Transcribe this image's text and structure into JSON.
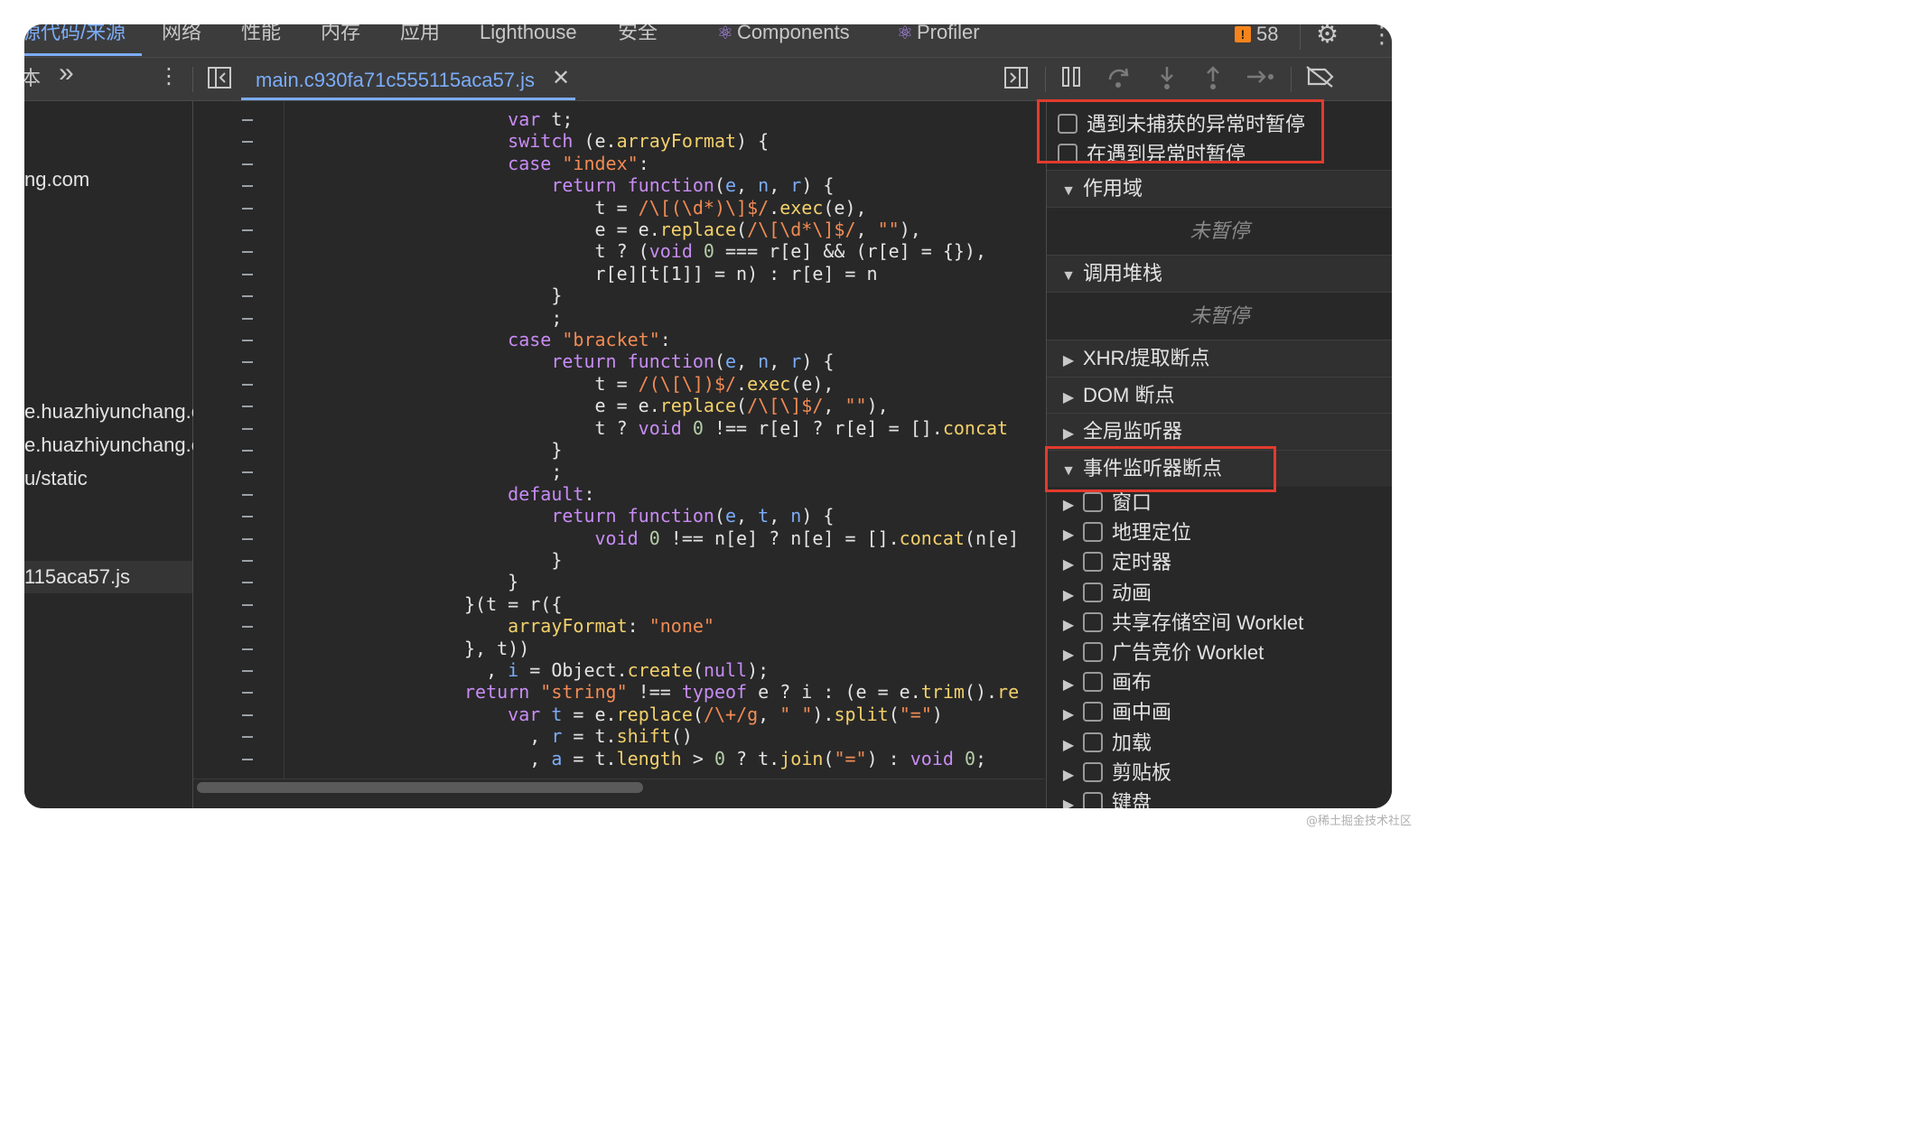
{
  "tabs": [
    "源代码/来源",
    "网络",
    "性能",
    "内存",
    "应用",
    "Lighthouse",
    "安全",
    "Components",
    "Profiler"
  ],
  "issues_count": "58",
  "toolbar": {
    "nav_overflow": "本",
    "more_tabs": "»",
    "file_tab": "main.c930fa71c555115aca57.js"
  },
  "navigator": {
    "items": [
      "ng.com",
      "e.huazhiyunchang.c",
      "e.huazhiyunchang.c",
      "u/static",
      "115aca57.js"
    ]
  },
  "code_lines": [
    [
      [
        "p",
        "    "
      ],
      [
        "kw",
        "var"
      ],
      [
        "p",
        " t;"
      ]
    ],
    [
      [
        "p",
        "    "
      ],
      [
        "kw",
        "switch"
      ],
      [
        "p",
        " (e."
      ],
      [
        "pr",
        "arrayFormat"
      ],
      [
        "p",
        ") {"
      ]
    ],
    [
      [
        "p",
        "    "
      ],
      [
        "kw",
        "case"
      ],
      [
        "p",
        " "
      ],
      [
        "str",
        "\"index\""
      ],
      [
        "p",
        ":"
      ]
    ],
    [
      [
        "p",
        "        "
      ],
      [
        "kw",
        "return"
      ],
      [
        "p",
        " "
      ],
      [
        "kw",
        "function"
      ],
      [
        "p",
        "("
      ],
      [
        "vr",
        "e"
      ],
      [
        "p",
        ", "
      ],
      [
        "vr",
        "n"
      ],
      [
        "p",
        ", "
      ],
      [
        "vr",
        "r"
      ],
      [
        "p",
        ") {"
      ]
    ],
    [
      [
        "p",
        "            t = "
      ],
      [
        "str",
        "/\\[(\\d*)\\]$/"
      ],
      [
        "p",
        "."
      ],
      [
        "fn",
        "exec"
      ],
      [
        "p",
        "(e),"
      ]
    ],
    [
      [
        "p",
        "            e = e."
      ],
      [
        "fn",
        "replace"
      ],
      [
        "p",
        "("
      ],
      [
        "str",
        "/\\[\\d*\\]$/"
      ],
      [
        "p",
        ", "
      ],
      [
        "str",
        "\"\""
      ],
      [
        "p",
        "),"
      ]
    ],
    [
      [
        "p",
        "            t ? ("
      ],
      [
        "kw",
        "void"
      ],
      [
        "p",
        " "
      ],
      [
        "num",
        "0"
      ],
      [
        "p",
        " === r[e] && (r[e] = {}),"
      ]
    ],
    [
      [
        "p",
        "            r[e][t[1]] = n) : r[e] = n"
      ]
    ],
    [
      [
        "p",
        "        }"
      ]
    ],
    [
      [
        "p",
        "        ;"
      ]
    ],
    [
      [
        "p",
        "    "
      ],
      [
        "kw",
        "case"
      ],
      [
        "p",
        " "
      ],
      [
        "str",
        "\"bracket\""
      ],
      [
        "p",
        ":"
      ]
    ],
    [
      [
        "p",
        "        "
      ],
      [
        "kw",
        "return"
      ],
      [
        "p",
        " "
      ],
      [
        "kw",
        "function"
      ],
      [
        "p",
        "("
      ],
      [
        "vr",
        "e"
      ],
      [
        "p",
        ", "
      ],
      [
        "vr",
        "n"
      ],
      [
        "p",
        ", "
      ],
      [
        "vr",
        "r"
      ],
      [
        "p",
        ") {"
      ]
    ],
    [
      [
        "p",
        "            t = "
      ],
      [
        "str",
        "/(\\[\\])$/"
      ],
      [
        "p",
        "."
      ],
      [
        "fn",
        "exec"
      ],
      [
        "p",
        "(e),"
      ]
    ],
    [
      [
        "p",
        "            e = e."
      ],
      [
        "fn",
        "replace"
      ],
      [
        "p",
        "("
      ],
      [
        "str",
        "/\\[\\]$/"
      ],
      [
        "p",
        ", "
      ],
      [
        "str",
        "\"\""
      ],
      [
        "p",
        "),"
      ]
    ],
    [
      [
        "p",
        "            t ? "
      ],
      [
        "kw",
        "void"
      ],
      [
        "p",
        " "
      ],
      [
        "num",
        "0"
      ],
      [
        "p",
        " !== r[e] ? r[e] = []."
      ],
      [
        "fn",
        "concat"
      ]
    ],
    [
      [
        "p",
        "        }"
      ]
    ],
    [
      [
        "p",
        "        ;"
      ]
    ],
    [
      [
        "p",
        "    "
      ],
      [
        "kw",
        "default"
      ],
      [
        "p",
        ":"
      ]
    ],
    [
      [
        "p",
        "        "
      ],
      [
        "kw",
        "return"
      ],
      [
        "p",
        " "
      ],
      [
        "kw",
        "function"
      ],
      [
        "p",
        "("
      ],
      [
        "vr",
        "e"
      ],
      [
        "p",
        ", "
      ],
      [
        "vr",
        "t"
      ],
      [
        "p",
        ", "
      ],
      [
        "vr",
        "n"
      ],
      [
        "p",
        ") {"
      ]
    ],
    [
      [
        "p",
        "            "
      ],
      [
        "kw",
        "void"
      ],
      [
        "p",
        " "
      ],
      [
        "num",
        "0"
      ],
      [
        "p",
        " !== n[e] ? n[e] = []."
      ],
      [
        "fn",
        "concat"
      ],
      [
        "p",
        "(n[e]"
      ]
    ],
    [
      [
        "p",
        "        }"
      ]
    ],
    [
      [
        "p",
        "    }"
      ]
    ],
    [
      [
        "p",
        "}(t = r({"
      ]
    ],
    [
      [
        "p",
        "    "
      ],
      [
        "pr",
        "arrayFormat"
      ],
      [
        "p",
        ": "
      ],
      [
        "str",
        "\"none\""
      ]
    ],
    [
      [
        "p",
        "}, t))"
      ]
    ],
    [
      [
        "p",
        "  , "
      ],
      [
        "vr",
        "i"
      ],
      [
        "p",
        " = Object."
      ],
      [
        "fn",
        "create"
      ],
      [
        "p",
        "("
      ],
      [
        "kw",
        "null"
      ],
      [
        "p",
        ");"
      ]
    ],
    [
      [
        "kw",
        "return"
      ],
      [
        "p",
        " "
      ],
      [
        "str",
        "\"string\""
      ],
      [
        "p",
        " !== "
      ],
      [
        "kw",
        "typeof"
      ],
      [
        "p",
        " e ? i : (e = e."
      ],
      [
        "fn",
        "trim"
      ],
      [
        "p",
        "()."
      ],
      [
        "fn",
        "re"
      ]
    ],
    [
      [
        "p",
        "    "
      ],
      [
        "kw",
        "var"
      ],
      [
        "p",
        " "
      ],
      [
        "vr",
        "t"
      ],
      [
        "p",
        " = e."
      ],
      [
        "fn",
        "replace"
      ],
      [
        "p",
        "("
      ],
      [
        "str",
        "/\\+/g"
      ],
      [
        "p",
        ", "
      ],
      [
        "str",
        "\" \""
      ],
      [
        "p",
        ")."
      ],
      [
        "fn",
        "split"
      ],
      [
        "p",
        "("
      ],
      [
        "str",
        "\"=\""
      ],
      [
        "p",
        ")"
      ]
    ],
    [
      [
        "p",
        "      , "
      ],
      [
        "vr",
        "r"
      ],
      [
        "p",
        " = t."
      ],
      [
        "fn",
        "shift"
      ],
      [
        "p",
        "()"
      ]
    ],
    [
      [
        "p",
        "      , "
      ],
      [
        "vr",
        "a"
      ],
      [
        "p",
        " = t."
      ],
      [
        "pr",
        "length"
      ],
      [
        "p",
        " > "
      ],
      [
        "num",
        "0"
      ],
      [
        "p",
        " ? t."
      ],
      [
        "fn",
        "join"
      ],
      [
        "p",
        "("
      ],
      [
        "str",
        "\"=\""
      ],
      [
        "p",
        ") : "
      ],
      [
        "kw",
        "void"
      ],
      [
        "p",
        " "
      ],
      [
        "num",
        "0"
      ],
      [
        "p",
        ";"
      ]
    ]
  ],
  "right_panel": {
    "pause_uncaught": "遇到未捕获的异常时暂停",
    "pause_caught": "在遇到异常时暂停",
    "scope_title": "作用域",
    "scope_status": "未暂停",
    "callstack_title": "调用堆栈",
    "callstack_status": "未暂停",
    "xhr_title": "XHR/提取断点",
    "dom_title": "DOM 断点",
    "global_title": "全局监听器",
    "event_title": "事件监听器断点",
    "event_items": [
      "窗口",
      "地理定位",
      "定时器",
      "动画",
      "共享存储空间 Worklet",
      "广告竞价 Worklet",
      "画布",
      "画中画",
      "加载",
      "剪贴板",
      "键盘"
    ]
  },
  "watermark": "@稀土掘金技术社区",
  "colors": {
    "highlight_box": "#e23b2e",
    "accent": "#7cacf8"
  }
}
